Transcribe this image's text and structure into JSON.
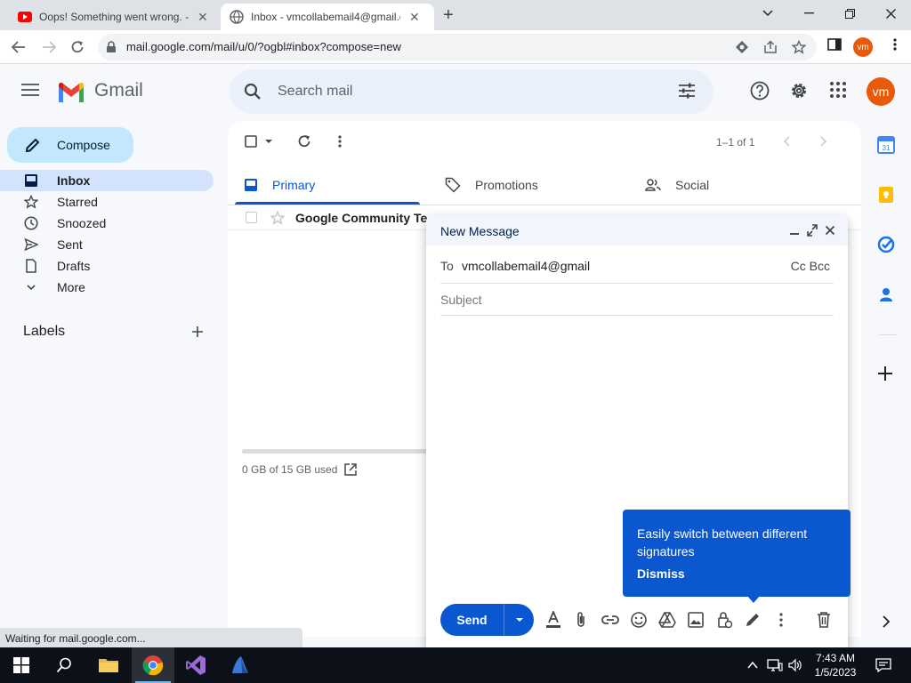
{
  "browser": {
    "tabs": [
      {
        "title": "Oops! Something went wrong. - ",
        "active": false
      },
      {
        "title": "Inbox - vmcollabemail4@gmail.c",
        "active": true
      }
    ],
    "url": "mail.google.com/mail/u/0/?ogbl#inbox?compose=new",
    "profile_initials": "vm"
  },
  "gmail": {
    "logo_text": "Gmail",
    "search_placeholder": "Search mail",
    "account_initials": "vm",
    "compose_label": "Compose",
    "nav": [
      {
        "label": "Inbox",
        "icon": "inbox-icon",
        "active": true
      },
      {
        "label": "Starred",
        "icon": "star-icon",
        "active": false
      },
      {
        "label": "Snoozed",
        "icon": "clock-icon",
        "active": false
      },
      {
        "label": "Sent",
        "icon": "send-icon",
        "active": false
      },
      {
        "label": "Drafts",
        "icon": "draft-icon",
        "active": false
      },
      {
        "label": "More",
        "icon": "chevron-down-icon",
        "active": false
      }
    ],
    "labels_heading": "Labels",
    "pager": "1–1 of 1",
    "categories": [
      {
        "label": "Primary",
        "icon": "inbox-icon",
        "active": true
      },
      {
        "label": "Promotions",
        "icon": "tag-icon",
        "active": false
      },
      {
        "label": "Social",
        "icon": "people-icon",
        "active": false
      }
    ],
    "messages": [
      {
        "sender": "Google Community Te"
      }
    ],
    "storage": "0 GB of 15 GB used"
  },
  "compose": {
    "title": "New Message",
    "to_label": "To",
    "to_value": "vmcollabemail4@gmail",
    "cc_bcc": "Cc Bcc",
    "subject_placeholder": "Subject",
    "send_label": "Send"
  },
  "tooltip": {
    "text": "Easily switch between different signatures",
    "dismiss": "Dismiss"
  },
  "status_text": "Waiting for mail.google.com...",
  "taskbar": {
    "time": "7:43 AM",
    "date": "1/5/2023"
  },
  "colors": {
    "accent": "#0b57d0",
    "compose_button": "#c2e7ff",
    "active_nav": "#d3e3fd",
    "avatar": "#e8590c"
  }
}
